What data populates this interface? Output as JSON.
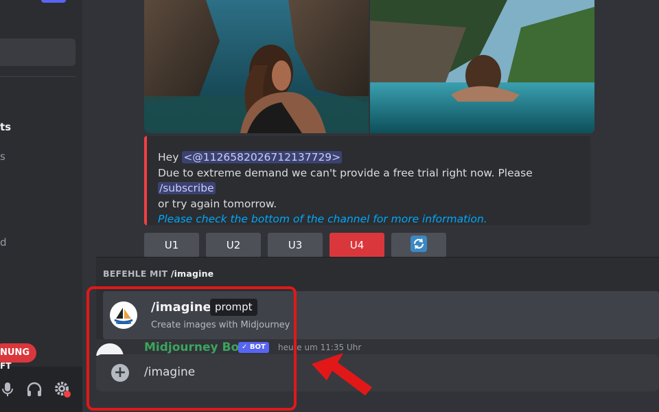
{
  "sidebar": {
    "frag_bold": "ts",
    "frag_1": "s",
    "frag_2": "d",
    "badge": "NUNG",
    "user_frag": "FT"
  },
  "embed": {
    "hey": "Hey",
    "mention": "<@1126582026712137729>",
    "line2_pre": "Due to extreme demand we can't provide a free trial right now. Please",
    "subscribe": "/subscribe",
    "line3": "or try again tomorrow.",
    "link": "Please check the bottom of the channel for more information."
  },
  "buttons": [
    {
      "label": "U1"
    },
    {
      "label": "U2"
    },
    {
      "label": "U3"
    },
    {
      "label": "U4"
    },
    {
      "label": "",
      "icon": "refresh-icon"
    }
  ],
  "popup": {
    "header_prefix": "BEFEHLE MIT",
    "header_cmd": "/imagine",
    "command": "/imagine",
    "option": "prompt",
    "description": "Create images with Midjourney"
  },
  "message": {
    "author": "Midjourney Bot",
    "bot_tag": "BOT",
    "time": "heute um 11:35 Uhr"
  },
  "composer": {
    "value": "/imagine"
  },
  "colors": {
    "accent_red": "#da373c",
    "highlight": "#e21818",
    "mention_bg": "#3c4270",
    "link": "#00a8fc"
  }
}
